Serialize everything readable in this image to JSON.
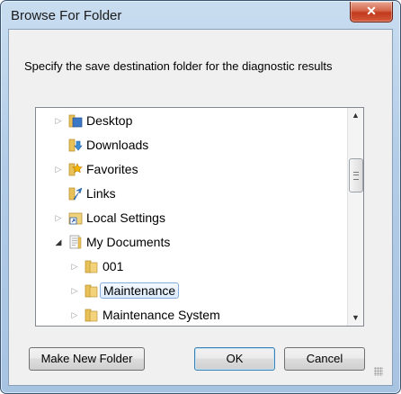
{
  "dialog": {
    "title": "Browse For Folder",
    "close_symbol": "✕",
    "instructions": "Specify the save destination folder for the diagnostic results"
  },
  "tree": {
    "items": [
      {
        "label": "Desktop",
        "icon": "desktop-folder-icon",
        "expander": "collapsed"
      },
      {
        "label": "Downloads",
        "icon": "downloads-folder-icon",
        "expander": "none"
      },
      {
        "label": "Favorites",
        "icon": "favorites-folder-icon",
        "expander": "collapsed"
      },
      {
        "label": "Links",
        "icon": "links-folder-icon",
        "expander": "none"
      },
      {
        "label": "Local Settings",
        "icon": "shortcut-folder-icon",
        "expander": "collapsed"
      },
      {
        "label": "My Documents",
        "icon": "documents-folder-icon",
        "expander": "expanded"
      },
      {
        "label": "001",
        "icon": "folder-icon",
        "expander": "collapsed"
      },
      {
        "label": "Maintenance",
        "icon": "folder-icon",
        "expander": "collapsed",
        "selected": true
      },
      {
        "label": "Maintenance System",
        "icon": "folder-icon",
        "expander": "collapsed"
      }
    ]
  },
  "buttons": {
    "new_folder": "Make New Folder",
    "ok": "OK",
    "cancel": "Cancel"
  },
  "colors": {
    "selection_border": "#84acdd",
    "frame": "#b3cde8",
    "close_button": "#c2391d"
  }
}
